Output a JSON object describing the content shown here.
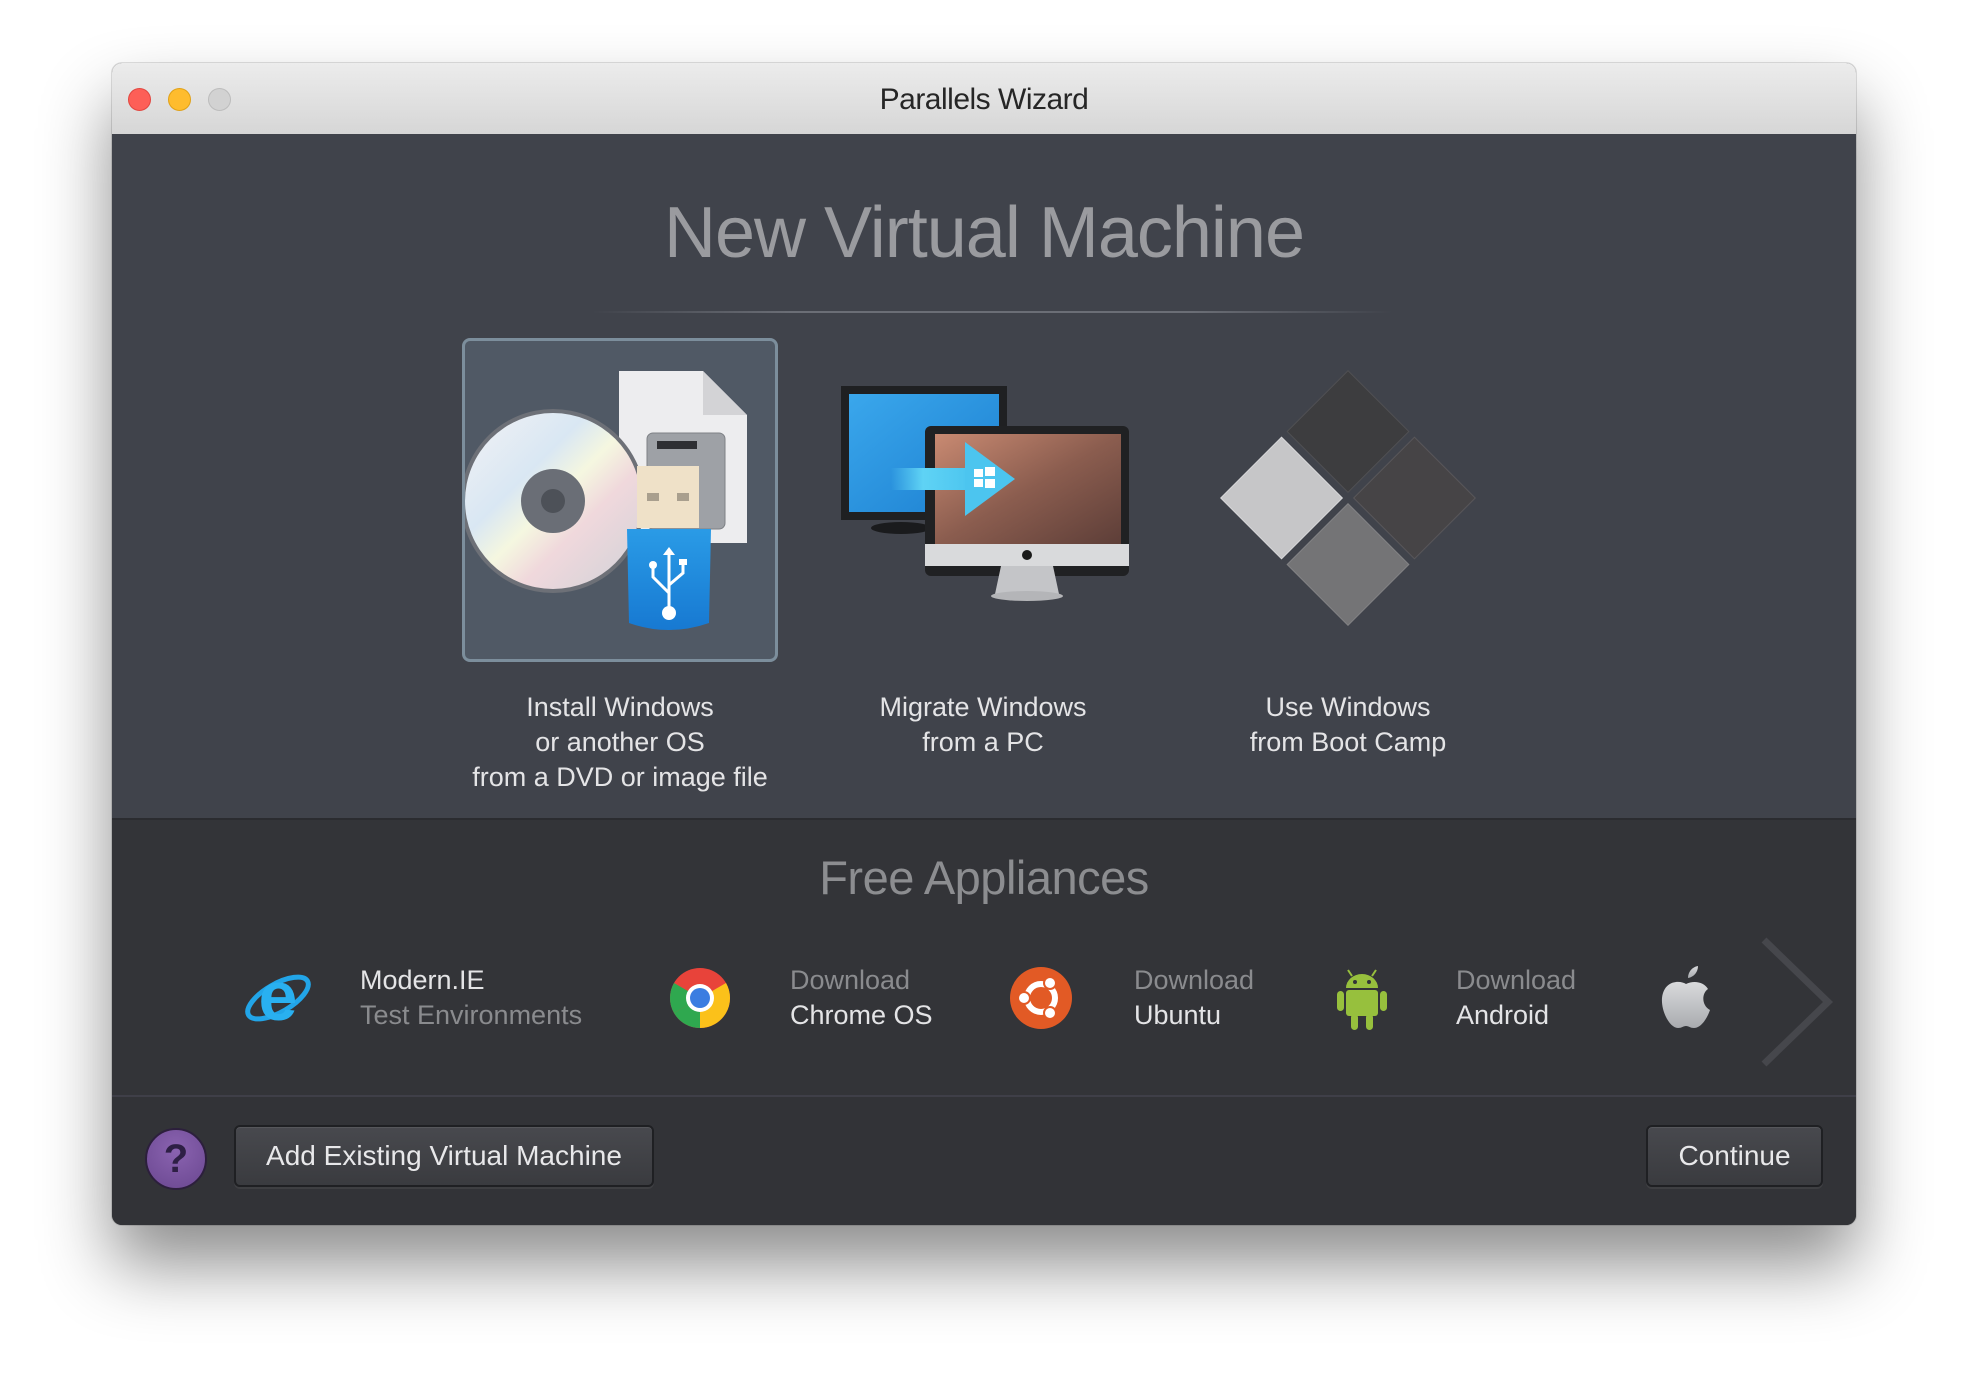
{
  "window": {
    "title": "Parallels Wizard",
    "traffic_lights": [
      "close",
      "minimize",
      "zoom"
    ]
  },
  "header": {
    "title": "New Virtual Machine"
  },
  "options": [
    {
      "id": "install",
      "label": "Install Windows\nor another OS\nfrom a DVD or image file",
      "icon": "dvd-usb-disk-icon",
      "selected": true
    },
    {
      "id": "migrate",
      "label": "Migrate Windows\nfrom a PC",
      "icon": "pc-to-mac-migrate-icon",
      "selected": false
    },
    {
      "id": "bootcamp",
      "label": "Use Windows\nfrom Boot Camp",
      "icon": "boot-camp-icon",
      "selected": false
    }
  ],
  "appliances": {
    "title": "Free Appliances",
    "items": [
      {
        "line1": "Modern.IE",
        "line2": "Test Environments",
        "icon": "internet-explorer-icon"
      },
      {
        "line1": "Download",
        "line2": "Chrome OS",
        "icon": "chrome-icon"
      },
      {
        "line1": "Download",
        "line2": "Ubuntu",
        "icon": "ubuntu-icon"
      },
      {
        "line1": "Download",
        "line2": "Android",
        "icon": "android-icon"
      },
      {
        "line1": "",
        "line2": "",
        "icon": "apple-icon"
      }
    ],
    "next_icon": "chevron-right-icon"
  },
  "footer": {
    "help_label": "?",
    "add_existing_label": "Add Existing Virtual Machine",
    "continue_label": "Continue"
  },
  "colors": {
    "upper_bg": "#40434b",
    "lower_bg": "#333438",
    "selection_bg": "#505965",
    "selection_border": "#7c8e9c",
    "help_purple": "#7a55a0"
  }
}
